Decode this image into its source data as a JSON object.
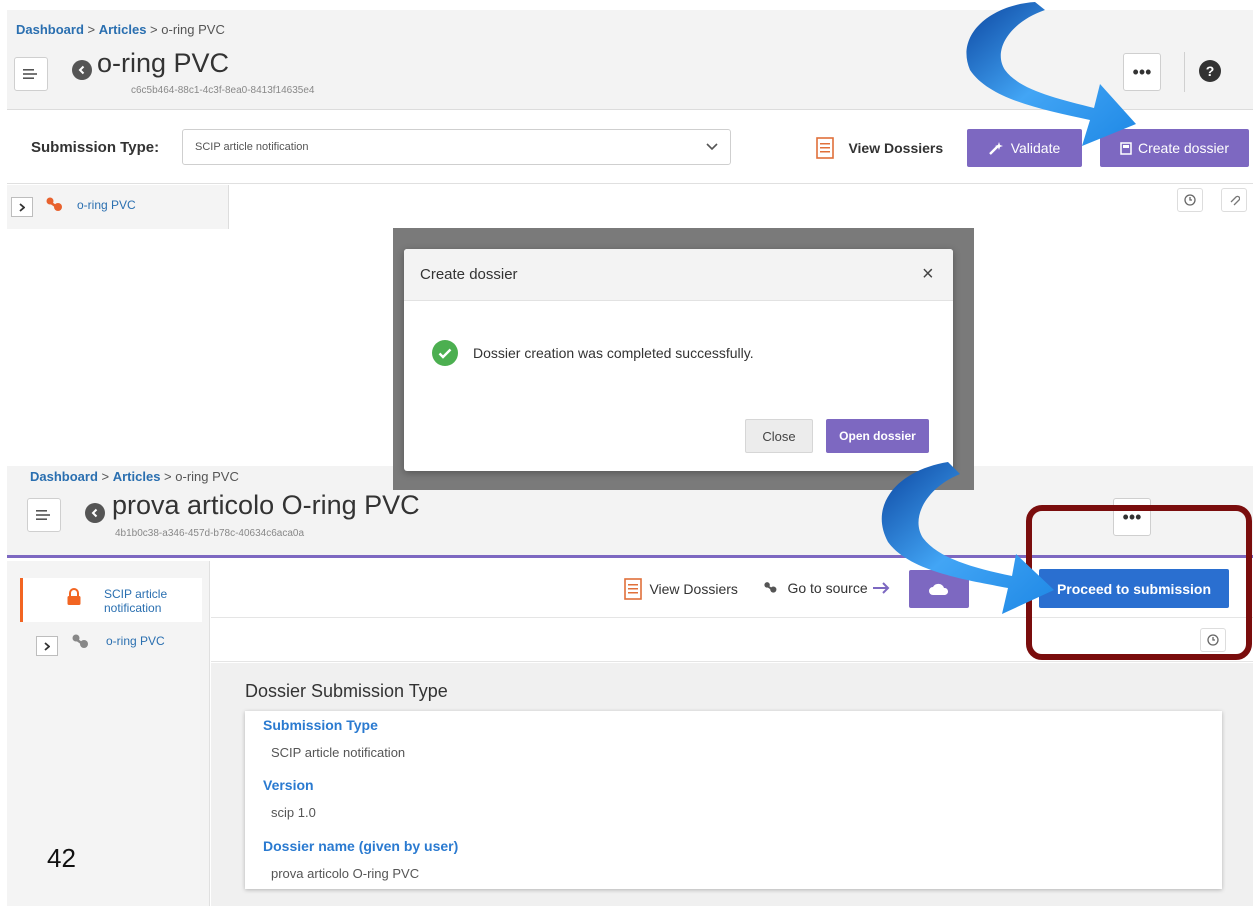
{
  "top": {
    "breadcrumb": {
      "dashboard": "Dashboard",
      "sep1": " > ",
      "articles": "Articles",
      "sep2": " > ",
      "current": "o-ring PVC"
    },
    "title": "o-ring PVC",
    "uuid": "c6c5b464-88c1-4c3f-8ea0-8413f14635e4",
    "more_label": "•••",
    "help_label": "?",
    "submission_type_label": "Submission Type:",
    "submission_type_value": "SCIP article notification",
    "view_dossiers": "View Dossiers",
    "validate": "Validate",
    "create_dossier": "Create dossier",
    "tree_item": "o-ring PVC"
  },
  "modal": {
    "title": "Create dossier",
    "close_x": "×",
    "message": "Dossier creation was completed successfully.",
    "close": "Close",
    "open": "Open dossier"
  },
  "bottom": {
    "breadcrumb": {
      "dashboard": "Dashboard",
      "sep1": " > ",
      "articles": "Articles",
      "sep2": " > ",
      "current": "o-ring PVC"
    },
    "title": "prova articolo O-ring PVC",
    "uuid": "4b1b0c38-a346-457d-b78c-40634c6aca0a",
    "more_label": "•••",
    "sidebar_item_line1": "SCIP article",
    "sidebar_item_line2": "notification",
    "tree_item": "o-ring PVC",
    "view_dossiers": "View Dossiers",
    "go_to_source": "Go to source",
    "proceed": "Proceed to submission",
    "section_title": "Dossier Submission Type",
    "fields": [
      {
        "label": "Submission Type",
        "value": "SCIP article notification"
      },
      {
        "label": "Version",
        "value": "scip 1.0"
      },
      {
        "label": "Dossier name (given by user)",
        "value": "prova articolo O-ring PVC"
      }
    ]
  },
  "page_number": "42",
  "colors": {
    "accent": "#7d68c1",
    "blue": "#2a6fd0",
    "link": "#2a6fb0",
    "highlight": "#7a0d0d",
    "arrow": "#1e88e5"
  }
}
